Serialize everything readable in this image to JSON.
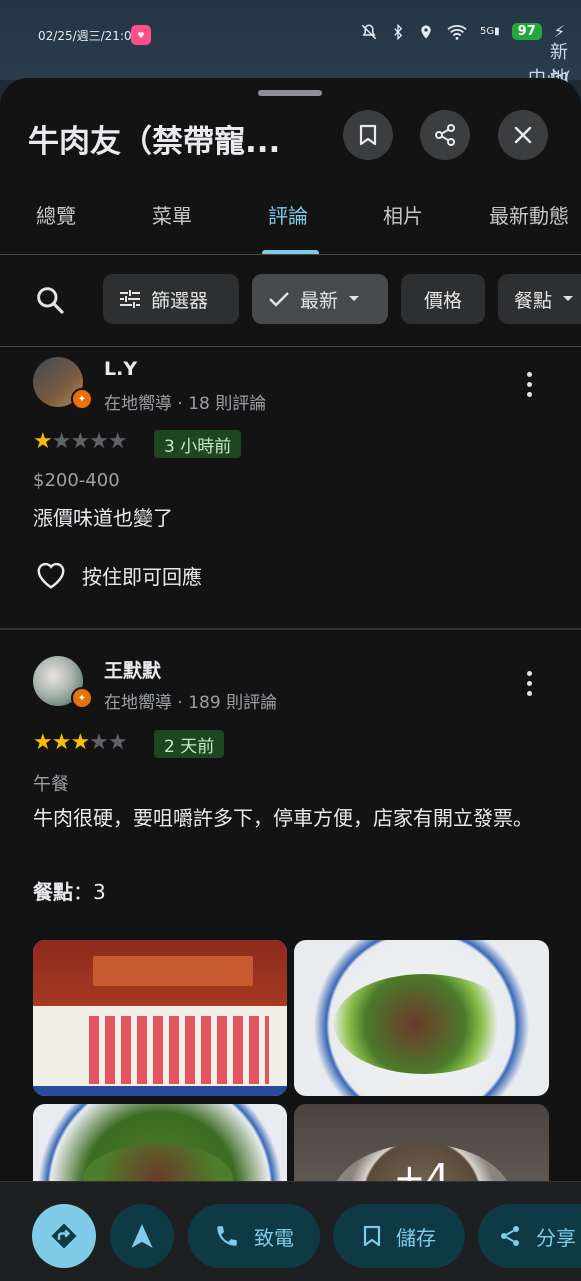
{
  "status": {
    "time": "02/25/週三/21:09",
    "network": "5G",
    "battery": "97"
  },
  "map_labels": [
    "新地",
    "中心("
  ],
  "place": {
    "title": "牛肉友（禁帶寵..."
  },
  "tabs": [
    "總覽",
    "菜單",
    "評論",
    "相片",
    "最新動態"
  ],
  "active_tab": "評論",
  "filters": {
    "filter_label": "篩選器",
    "sort_label": "最新",
    "price_label": "價格",
    "meal_label": "餐點"
  },
  "reviews": [
    {
      "name": "L.Y",
      "meta": "在地嚮導 · 18 則評論",
      "rating": 1,
      "time": "3 小時前",
      "price": "$200-400",
      "text": "漲價味道也變了",
      "like_label": "按住即可回應"
    },
    {
      "name": "王默默",
      "meta": "在地嚮導 · 189 則評論",
      "rating": 3,
      "time": "2 天前",
      "meal_type": "午餐",
      "text": "牛肉很硬，要咀嚼許多下，停車方便，店家有開立發票。",
      "food_label": "餐點",
      "food_value": "：3",
      "more_photos": "+4"
    }
  ],
  "actions": {
    "call_label": "致電",
    "save_label": "儲存",
    "share_label": "分享"
  },
  "colors": {
    "accent": "#80cbe8",
    "star": "#fbbc04",
    "badge_bg": "#1e4620"
  }
}
